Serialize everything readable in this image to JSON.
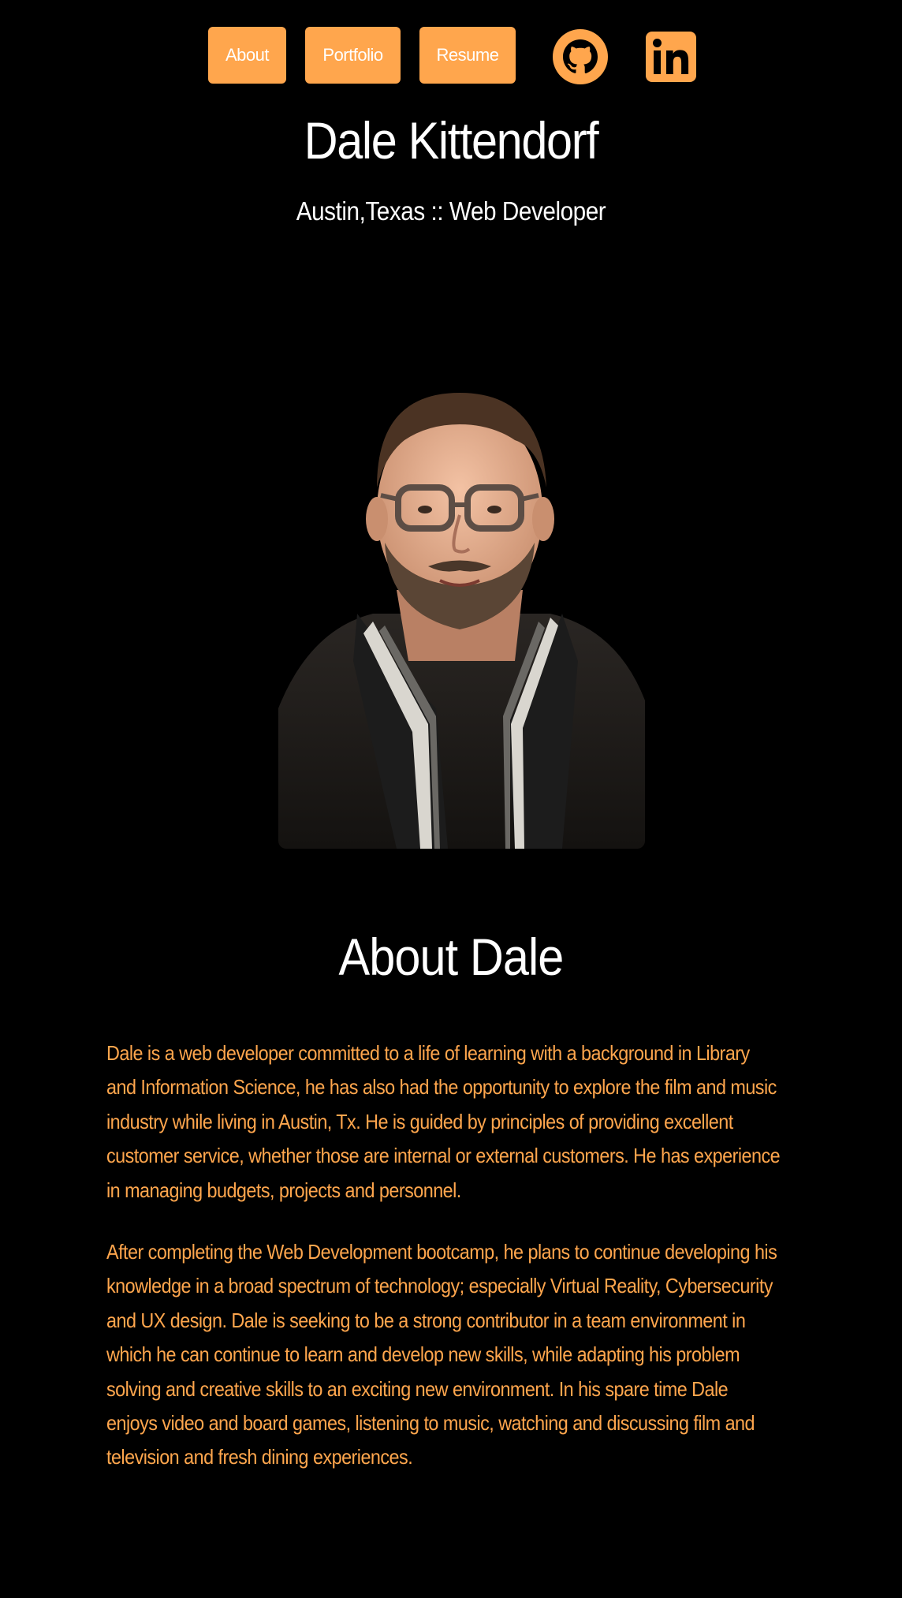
{
  "nav": {
    "about": "About",
    "portfolio": "Portfolio",
    "resume": "Resume",
    "github_icon": "github-icon",
    "linkedin_icon": "linkedin-icon"
  },
  "header": {
    "name": "Dale Kittendorf",
    "tagline": "Austin,Texas :: Web Developer"
  },
  "portrait": {
    "alt": "Portrait of Dale Kittendorf"
  },
  "about": {
    "heading": "About Dale",
    "paragraphs": [
      "Dale is a web developer committed to a life of learning with a background in Library and Information Science, he has also had the opportunity to explore the film and music industry while living in Austin, Tx. He is guided by principles of providing excellent customer service, whether those are internal or external customers. He has experience in managing budgets, projects and personnel.",
      "After completing the Web Development bootcamp, he plans to continue developing his knowledge in a broad spectrum of technology; especially Virtual Reality, Cybersecurity and UX design. Dale is seeking to be a strong contributor in a team environment in which he can continue to learn and develop new skills, while adapting his problem solving and creative skills to an exciting new environment. In his spare time Dale enjoys video and board games, listening to music, watching and discussing film and television and fresh dining experiences."
    ]
  },
  "colors": {
    "background": "#000000",
    "accent": "#ffa64d",
    "text": "#ffffff"
  }
}
